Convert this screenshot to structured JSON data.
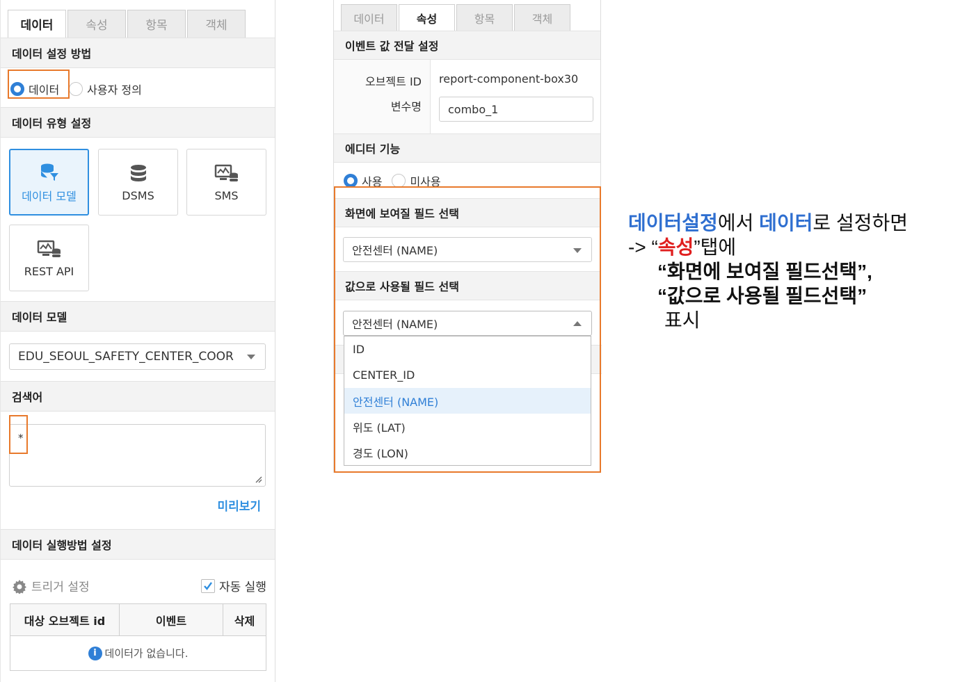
{
  "left": {
    "tabs": [
      "데이터",
      "속성",
      "항목",
      "객체"
    ],
    "data_setting_title": "데이터 설정 방법",
    "radio_data": "데이터",
    "radio_custom": "사용자 정의",
    "data_type_title": "데이터 유형 설정",
    "types": [
      "데이터 모델",
      "DSMS",
      "SMS",
      "REST API"
    ],
    "data_model_title": "데이터 모델",
    "data_model_value": "EDU_SEOUL_SAFETY_CENTER_COOR",
    "search_title": "검색어",
    "search_value": "*",
    "preview": "미리보기",
    "exec_title": "데이터 실행방법 설정",
    "trigger_label": "트리거 설정",
    "auto_run": "자동 실행",
    "table_headers": [
      "대상 오브젝트 id",
      "이벤트",
      "삭제"
    ],
    "empty_msg": "데이터가 없습니다."
  },
  "mid": {
    "tabs": [
      "데이터",
      "속성",
      "항목",
      "객체"
    ],
    "event_title": "이벤트 값 전달 설정",
    "object_id_label": "오브젝트 ID",
    "object_id_value": "report-component-box30",
    "var_label": "변수명",
    "var_value": "combo_1",
    "editor_title": "에디터 기능",
    "use": "사용",
    "unused": "미사용",
    "display_field_title": "화면에 보여질 필드 선택",
    "display_field_value": "안전센터 (NAME)",
    "value_field_title": "값으로 사용될 필드 선택",
    "value_field_value": "안전센터 (NAME)",
    "options": [
      "ID",
      "CENTER_ID",
      "안전센터 (NAME)",
      "위도 (LAT)",
      "경도 (LON)"
    ]
  },
  "note": {
    "l1a": "데이터설정",
    "l1b": "에서 ",
    "l1c": "데이터",
    "l1d": "로 설정하면",
    "l2a": "-> “",
    "l2b": "속성",
    "l2c": "”탭에",
    "l3": "“화면에 보여질 필드선택”,",
    "l4": "“값으로 사용될 필드선택”",
    "l5": "표시"
  },
  "colors": {
    "accent": "#2f8fe0",
    "highlight": "#e8792b",
    "red": "#e01f1f"
  }
}
